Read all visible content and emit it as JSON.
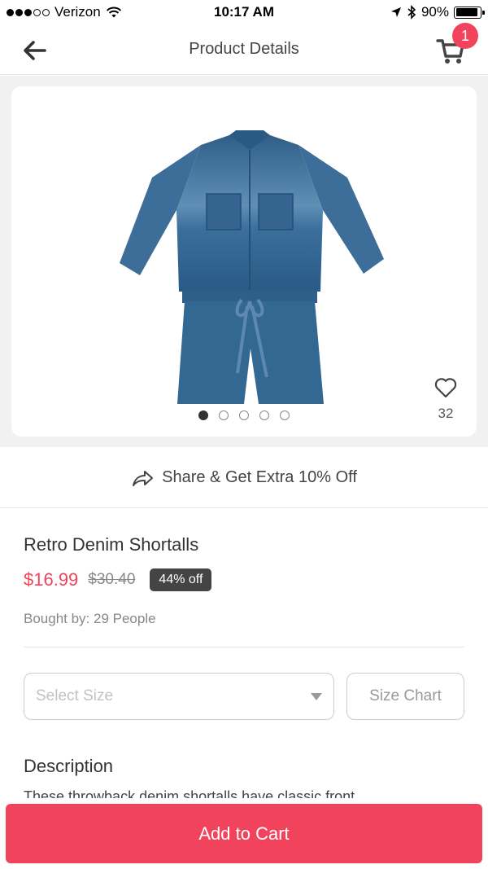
{
  "status_bar": {
    "carrier": "Verizon",
    "time": "10:17 AM",
    "battery": "90%",
    "battery_level": 0.9,
    "signal_dots_filled": 3,
    "signal_dots_total": 5
  },
  "nav": {
    "title": "Product Details",
    "cart_count": "1",
    "back_icon": "arrow-left-icon",
    "cart_icon": "cart-icon"
  },
  "gallery": {
    "image_count": 5,
    "active_index": 0,
    "favorite_count": "32"
  },
  "share": {
    "label": "Share & Get Extra 10% Off"
  },
  "product": {
    "name": "Retro Denim Shortalls",
    "price": "$16.99",
    "original_price": "$30.40",
    "discount": "44% off",
    "bought_by": "Bought by: 29 People"
  },
  "size": {
    "placeholder": "Select Size",
    "chart_label": "Size Chart"
  },
  "description": {
    "title": "Description",
    "text": "These throwback denim shortalls have classic front"
  },
  "footer": {
    "add_to_cart": "Add to Cart"
  },
  "colors": {
    "accent": "#f2435c",
    "denim": "#3f6f98"
  }
}
